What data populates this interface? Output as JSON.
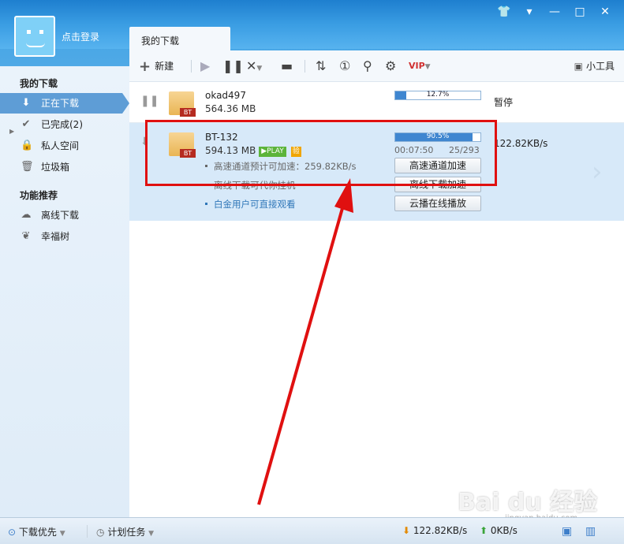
{
  "user": {
    "login_label": "点击登录"
  },
  "window_buttons": [
    "👕",
    "▾",
    "—",
    "□",
    "✕"
  ],
  "tab": {
    "label": "我的下载"
  },
  "sidebar": {
    "section1": "我的下载",
    "items": [
      {
        "label": "正在下载",
        "icon": "download-icon"
      },
      {
        "label": "已完成(2)",
        "icon": "check-icon"
      },
      {
        "label": "私人空间",
        "icon": "lock-icon"
      },
      {
        "label": "垃圾箱",
        "icon": "trash-icon"
      }
    ],
    "section2": "功能推荐",
    "features": [
      {
        "label": "离线下载",
        "icon": "cloud-icon"
      },
      {
        "label": "幸福树",
        "icon": "leaf-icon"
      }
    ]
  },
  "toolbar": {
    "new_label": "新建",
    "tools_label": "小工具"
  },
  "tasks": [
    {
      "name": "okad497",
      "size": "564.36 MB",
      "progress_text": "12.7%",
      "progress": 0.127,
      "status": "暂停"
    },
    {
      "name": "BT-132",
      "size": "594.13 MB",
      "progress_text": "90.5%",
      "progress": 0.905,
      "time_left": "00:07:50",
      "pieces": "25/293",
      "speed": "122.82KB/s",
      "play_badge": "▶PLAY",
      "verify_badge": "验",
      "hint1": "高速通道预计可加速：259.82KB/s",
      "hint2": "离线下载可代你挂机",
      "hint3": "白金用户可直接观看",
      "btn1": "高速通道加速",
      "btn2": "离线下载加速",
      "btn3": "云播在线播放"
    }
  ],
  "statusbar": {
    "priority": "下载优先",
    "schedule": "计划任务",
    "down_speed": "122.82KB/s",
    "up_speed": "0KB/s"
  },
  "watermark": {
    "text": "Bai du 经验",
    "sub": "jingyan.baidu.com"
  }
}
